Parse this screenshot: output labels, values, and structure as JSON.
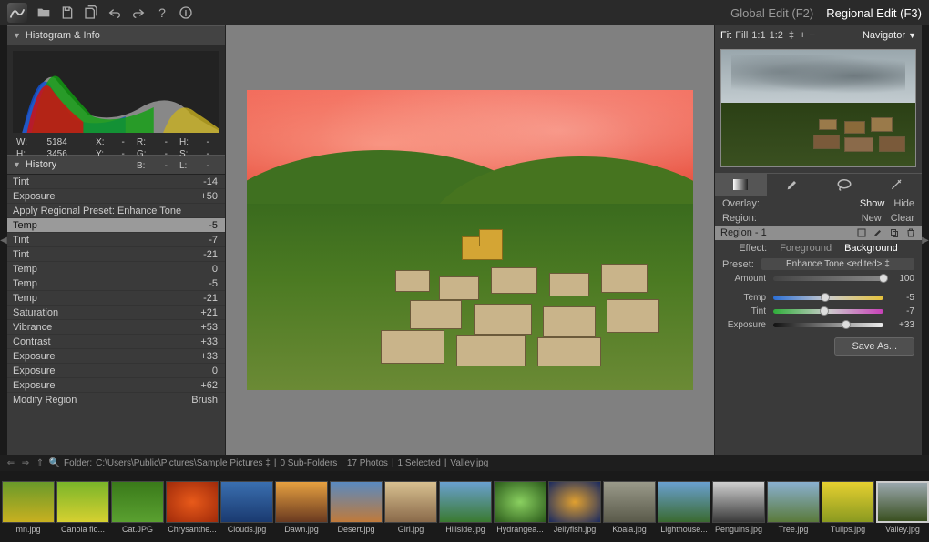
{
  "modes": {
    "global": "Global Edit (F2)",
    "regional": "Regional Edit (F3)"
  },
  "left": {
    "histo_title": "Histogram & Info",
    "stats": {
      "w": "5184",
      "h": "3456",
      "x": "-",
      "y": "-",
      "r": "-",
      "g": "-",
      "b": "-",
      "hv": "-",
      "s": "-",
      "l": "-"
    },
    "history_title": "History",
    "history": [
      {
        "label": "Tint",
        "val": "-14"
      },
      {
        "label": "Exposure",
        "val": "+50"
      },
      {
        "label": "Apply Regional Preset: Enhance Tone",
        "val": ""
      },
      {
        "label": "Temp",
        "val": "-5",
        "selected": true
      },
      {
        "label": "Tint",
        "val": "-7"
      },
      {
        "label": "Tint",
        "val": "-21"
      },
      {
        "label": "Temp",
        "val": "0"
      },
      {
        "label": "Temp",
        "val": "-5"
      },
      {
        "label": "Temp",
        "val": "-21"
      },
      {
        "label": "Saturation",
        "val": "+21"
      },
      {
        "label": "Vibrance",
        "val": "+53"
      },
      {
        "label": "Contrast",
        "val": "+33"
      },
      {
        "label": "Exposure",
        "val": "+33"
      },
      {
        "label": "Exposure",
        "val": "0"
      },
      {
        "label": "Exposure",
        "val": "+62"
      },
      {
        "label": "Modify Region",
        "val": "Brush"
      }
    ]
  },
  "right": {
    "zoom": [
      "Fit",
      "Fill",
      "1:1",
      "1:2"
    ],
    "zoom_extra": [
      "+",
      "−"
    ],
    "nav_label": "Navigator",
    "overlay_label": "Overlay:",
    "overlay_opts": {
      "show": "Show",
      "hide": "Hide"
    },
    "region_label": "Region:",
    "region_opts": {
      "new": "New",
      "clear": "Clear"
    },
    "region_name": "Region - 1",
    "effect_label": "Effect:",
    "effect_opts": {
      "fg": "Foreground",
      "bg": "Background"
    },
    "preset_label": "Preset:",
    "preset_value": "Enhance Tone <edited> ‡",
    "sliders": {
      "amount": {
        "label": "Amount",
        "val": "100",
        "pos": 100
      },
      "temp": {
        "label": "Temp",
        "val": "-5",
        "pos": 47
      },
      "tint": {
        "label": "Tint",
        "val": "-7",
        "pos": 46
      },
      "exposure": {
        "label": "Exposure",
        "val": "+33",
        "pos": 66
      }
    },
    "save": "Save As..."
  },
  "statusbar": {
    "folder_label": "Folder:",
    "folder_path": "C:\\Users\\Public\\Pictures\\Sample Pictures ‡",
    "subfolders": "0 Sub-Folders",
    "photos": "17 Photos",
    "selected": "1 Selected",
    "current": "Valley.jpg"
  },
  "thumbs": [
    {
      "label": "mn.jpg",
      "bg": "linear-gradient(#6a9a2a,#c8b020)"
    },
    {
      "label": "Canola flo...",
      "bg": "linear-gradient(#7ab52a,#d6d030)"
    },
    {
      "label": "Cat.JPG",
      "bg": "linear-gradient(#3a7a1a,#5aa030)"
    },
    {
      "label": "Chrysanthe...",
      "bg": "radial-gradient(#e85a1a,#a02a0a)"
    },
    {
      "label": "Clouds.jpg",
      "bg": "linear-gradient(#3a6fb0,#1a3a70)"
    },
    {
      "label": "Dawn.jpg",
      "bg": "linear-gradient(#e6a040,#6a3a20)"
    },
    {
      "label": "Desert.jpg",
      "bg": "linear-gradient(#5a8ac0,#c07a3a)"
    },
    {
      "label": "Girl.jpg",
      "bg": "linear-gradient(#d8c090,#8a6a4a)"
    },
    {
      "label": "Hillside.jpg",
      "bg": "linear-gradient(#6aa0d0,#3a7a30)"
    },
    {
      "label": "Hydrangea...",
      "bg": "radial-gradient(#8ad060,#2a5a1a)"
    },
    {
      "label": "Jellyfish.jpg",
      "bg": "radial-gradient(#e0a030,#1a2a60)"
    },
    {
      "label": "Koala.jpg",
      "bg": "linear-gradient(#9a9a8a,#5a5a4a)"
    },
    {
      "label": "Lighthouse...",
      "bg": "linear-gradient(#6aa0d0,#3a6a30)"
    },
    {
      "label": "Penguins.jpg",
      "bg": "linear-gradient(#d0d0d0,#3a3a3a)"
    },
    {
      "label": "Tree.jpg",
      "bg": "linear-gradient(#8ab0d0,#5a7a3a)"
    },
    {
      "label": "Tulips.jpg",
      "bg": "linear-gradient(#e6d030,#8a9a20)"
    },
    {
      "label": "Valley.jpg",
      "bg": "linear-gradient(#9aa7ad,#3a5020)",
      "selected": true
    }
  ]
}
